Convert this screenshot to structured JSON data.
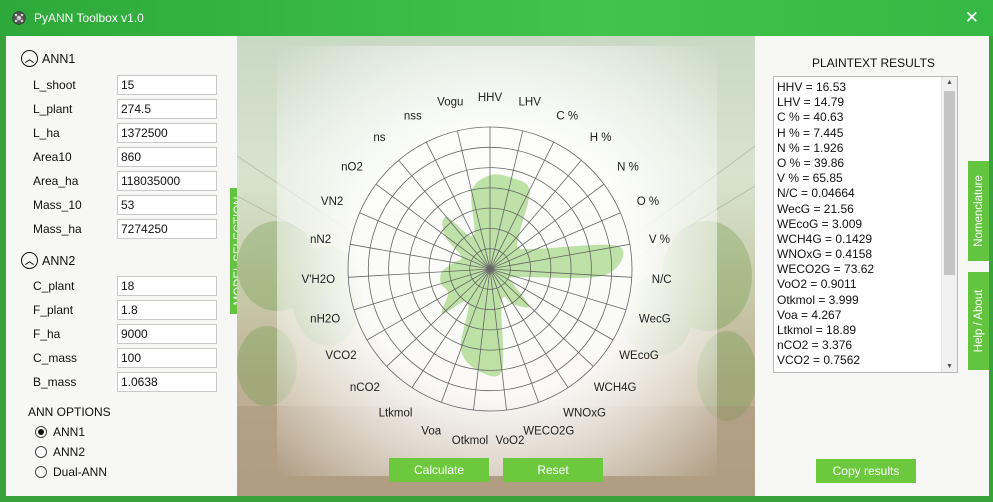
{
  "window": {
    "title": "PyANN Toolbox v1.0",
    "close_glyph": "✕"
  },
  "ann1": {
    "title": "ANN1",
    "params": [
      {
        "label": "L_shoot",
        "value": "15"
      },
      {
        "label": "L_plant",
        "value": "274.5"
      },
      {
        "label": "L_ha",
        "value": "1372500"
      },
      {
        "label": "Area10",
        "value": "860"
      },
      {
        "label": "Area_ha",
        "value": "118035000"
      },
      {
        "label": "Mass_10",
        "value": "53"
      },
      {
        "label": "Mass_ha",
        "value": "7274250"
      }
    ]
  },
  "ann2": {
    "title": "ANN2",
    "params": [
      {
        "label": "C_plant",
        "value": "18"
      },
      {
        "label": "F_plant",
        "value": "1.8"
      },
      {
        "label": "F_ha",
        "value": "9000"
      },
      {
        "label": "C_mass",
        "value": "100"
      },
      {
        "label": "B_mass",
        "value": "1.0638"
      }
    ]
  },
  "options": {
    "title": "ANN OPTIONS",
    "items": [
      {
        "label": "ANN1",
        "selected": true
      },
      {
        "label": "ANN2",
        "selected": false
      },
      {
        "label": "Dual-ANN",
        "selected": false
      }
    ]
  },
  "tabs": {
    "model_selection": "MODEL SELECTION",
    "nomenclature": "Nomenclature",
    "help": "Help / About"
  },
  "buttons": {
    "calculate": "Calculate",
    "reset": "Reset",
    "copy": "Copy results"
  },
  "results": {
    "title": "PLAINTEXT RESULTS",
    "lines": [
      "HHV = 16.53",
      "LHV = 14.79",
      "C % = 40.63",
      "H % = 7.445",
      "N % = 1.926",
      "O % = 39.86",
      "V % = 65.85",
      "N/C = 0.04664",
      "WecG = 21.56",
      "WEcoG = 3.009",
      "WCH4G = 0.1429",
      "WNOxG = 0.4158",
      "WECO2G = 73.62",
      "VoO2 = 0.9011",
      "Otkmol = 3.999",
      "Voa = 4.267",
      "Ltkmol = 18.89",
      "nCO2 = 3.376",
      "VCO2 = 0.7562"
    ]
  },
  "chart_data": {
    "type": "radar",
    "categories": [
      "HHV",
      "LHV",
      "C %",
      "H %",
      "N %",
      "O %",
      "V %",
      "N/C",
      "WecG",
      "WEcoG",
      "WCH4G",
      "WNOxG",
      "WECO2G",
      "VoO2",
      "Otkmol",
      "Voa",
      "Ltkmol",
      "nCO2",
      "VCO2",
      "nH2O",
      "V'H2O",
      "nN2",
      "VN2",
      "nO2",
      "ns",
      "nss",
      "Vogu"
    ],
    "values": [
      0.66,
      0.66,
      0.62,
      0.32,
      0.25,
      0.36,
      0.92,
      0.8,
      0.2,
      0.18,
      0.38,
      0.3,
      0.24,
      0.72,
      0.72,
      0.6,
      0.28,
      0.46,
      0.34,
      0.36,
      0.34,
      0.26,
      0.22,
      0.4,
      0.48,
      0.26,
      0.56
    ],
    "rings": 7,
    "fill_color": "#a8d88a"
  },
  "colors": {
    "accent": "#63c43f",
    "titlebar": "#36b844"
  }
}
